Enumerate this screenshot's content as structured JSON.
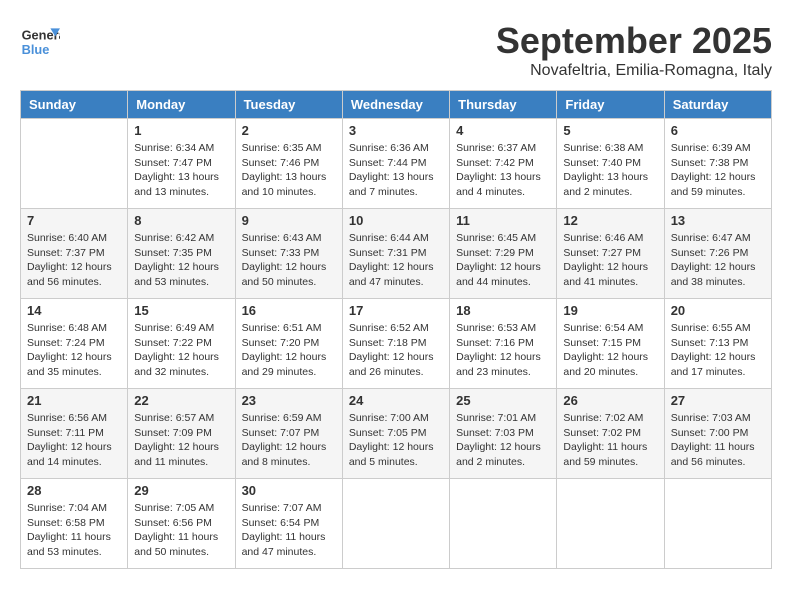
{
  "header": {
    "logo_general": "General",
    "logo_blue": "Blue",
    "month_year": "September 2025",
    "location": "Novafeltria, Emilia-Romagna, Italy"
  },
  "weekdays": [
    "Sunday",
    "Monday",
    "Tuesday",
    "Wednesday",
    "Thursday",
    "Friday",
    "Saturday"
  ],
  "weeks": [
    [
      {
        "day": "",
        "sunrise": "",
        "sunset": "",
        "daylight": ""
      },
      {
        "day": "1",
        "sunrise": "Sunrise: 6:34 AM",
        "sunset": "Sunset: 7:47 PM",
        "daylight": "Daylight: 13 hours and 13 minutes."
      },
      {
        "day": "2",
        "sunrise": "Sunrise: 6:35 AM",
        "sunset": "Sunset: 7:46 PM",
        "daylight": "Daylight: 13 hours and 10 minutes."
      },
      {
        "day": "3",
        "sunrise": "Sunrise: 6:36 AM",
        "sunset": "Sunset: 7:44 PM",
        "daylight": "Daylight: 13 hours and 7 minutes."
      },
      {
        "day": "4",
        "sunrise": "Sunrise: 6:37 AM",
        "sunset": "Sunset: 7:42 PM",
        "daylight": "Daylight: 13 hours and 4 minutes."
      },
      {
        "day": "5",
        "sunrise": "Sunrise: 6:38 AM",
        "sunset": "Sunset: 7:40 PM",
        "daylight": "Daylight: 13 hours and 2 minutes."
      },
      {
        "day": "6",
        "sunrise": "Sunrise: 6:39 AM",
        "sunset": "Sunset: 7:38 PM",
        "daylight": "Daylight: 12 hours and 59 minutes."
      }
    ],
    [
      {
        "day": "7",
        "sunrise": "Sunrise: 6:40 AM",
        "sunset": "Sunset: 7:37 PM",
        "daylight": "Daylight: 12 hours and 56 minutes."
      },
      {
        "day": "8",
        "sunrise": "Sunrise: 6:42 AM",
        "sunset": "Sunset: 7:35 PM",
        "daylight": "Daylight: 12 hours and 53 minutes."
      },
      {
        "day": "9",
        "sunrise": "Sunrise: 6:43 AM",
        "sunset": "Sunset: 7:33 PM",
        "daylight": "Daylight: 12 hours and 50 minutes."
      },
      {
        "day": "10",
        "sunrise": "Sunrise: 6:44 AM",
        "sunset": "Sunset: 7:31 PM",
        "daylight": "Daylight: 12 hours and 47 minutes."
      },
      {
        "day": "11",
        "sunrise": "Sunrise: 6:45 AM",
        "sunset": "Sunset: 7:29 PM",
        "daylight": "Daylight: 12 hours and 44 minutes."
      },
      {
        "day": "12",
        "sunrise": "Sunrise: 6:46 AM",
        "sunset": "Sunset: 7:27 PM",
        "daylight": "Daylight: 12 hours and 41 minutes."
      },
      {
        "day": "13",
        "sunrise": "Sunrise: 6:47 AM",
        "sunset": "Sunset: 7:26 PM",
        "daylight": "Daylight: 12 hours and 38 minutes."
      }
    ],
    [
      {
        "day": "14",
        "sunrise": "Sunrise: 6:48 AM",
        "sunset": "Sunset: 7:24 PM",
        "daylight": "Daylight: 12 hours and 35 minutes."
      },
      {
        "day": "15",
        "sunrise": "Sunrise: 6:49 AM",
        "sunset": "Sunset: 7:22 PM",
        "daylight": "Daylight: 12 hours and 32 minutes."
      },
      {
        "day": "16",
        "sunrise": "Sunrise: 6:51 AM",
        "sunset": "Sunset: 7:20 PM",
        "daylight": "Daylight: 12 hours and 29 minutes."
      },
      {
        "day": "17",
        "sunrise": "Sunrise: 6:52 AM",
        "sunset": "Sunset: 7:18 PM",
        "daylight": "Daylight: 12 hours and 26 minutes."
      },
      {
        "day": "18",
        "sunrise": "Sunrise: 6:53 AM",
        "sunset": "Sunset: 7:16 PM",
        "daylight": "Daylight: 12 hours and 23 minutes."
      },
      {
        "day": "19",
        "sunrise": "Sunrise: 6:54 AM",
        "sunset": "Sunset: 7:15 PM",
        "daylight": "Daylight: 12 hours and 20 minutes."
      },
      {
        "day": "20",
        "sunrise": "Sunrise: 6:55 AM",
        "sunset": "Sunset: 7:13 PM",
        "daylight": "Daylight: 12 hours and 17 minutes."
      }
    ],
    [
      {
        "day": "21",
        "sunrise": "Sunrise: 6:56 AM",
        "sunset": "Sunset: 7:11 PM",
        "daylight": "Daylight: 12 hours and 14 minutes."
      },
      {
        "day": "22",
        "sunrise": "Sunrise: 6:57 AM",
        "sunset": "Sunset: 7:09 PM",
        "daylight": "Daylight: 12 hours and 11 minutes."
      },
      {
        "day": "23",
        "sunrise": "Sunrise: 6:59 AM",
        "sunset": "Sunset: 7:07 PM",
        "daylight": "Daylight: 12 hours and 8 minutes."
      },
      {
        "day": "24",
        "sunrise": "Sunrise: 7:00 AM",
        "sunset": "Sunset: 7:05 PM",
        "daylight": "Daylight: 12 hours and 5 minutes."
      },
      {
        "day": "25",
        "sunrise": "Sunrise: 7:01 AM",
        "sunset": "Sunset: 7:03 PM",
        "daylight": "Daylight: 12 hours and 2 minutes."
      },
      {
        "day": "26",
        "sunrise": "Sunrise: 7:02 AM",
        "sunset": "Sunset: 7:02 PM",
        "daylight": "Daylight: 11 hours and 59 minutes."
      },
      {
        "day": "27",
        "sunrise": "Sunrise: 7:03 AM",
        "sunset": "Sunset: 7:00 PM",
        "daylight": "Daylight: 11 hours and 56 minutes."
      }
    ],
    [
      {
        "day": "28",
        "sunrise": "Sunrise: 7:04 AM",
        "sunset": "Sunset: 6:58 PM",
        "daylight": "Daylight: 11 hours and 53 minutes."
      },
      {
        "day": "29",
        "sunrise": "Sunrise: 7:05 AM",
        "sunset": "Sunset: 6:56 PM",
        "daylight": "Daylight: 11 hours and 50 minutes."
      },
      {
        "day": "30",
        "sunrise": "Sunrise: 7:07 AM",
        "sunset": "Sunset: 6:54 PM",
        "daylight": "Daylight: 11 hours and 47 minutes."
      },
      {
        "day": "",
        "sunrise": "",
        "sunset": "",
        "daylight": ""
      },
      {
        "day": "",
        "sunrise": "",
        "sunset": "",
        "daylight": ""
      },
      {
        "day": "",
        "sunrise": "",
        "sunset": "",
        "daylight": ""
      },
      {
        "day": "",
        "sunrise": "",
        "sunset": "",
        "daylight": ""
      }
    ]
  ]
}
